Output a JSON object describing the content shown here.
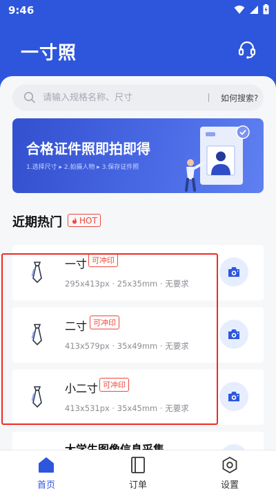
{
  "status_bar": {
    "time": "9:46"
  },
  "header": {
    "title": "一寸照"
  },
  "search": {
    "placeholder": "请输入规格名称、尺寸",
    "help_label": "如何搜索?"
  },
  "banner": {
    "title": "合格证件照即拍即得",
    "steps": "1.选择尺寸 ▸ 2.拍摄人物 ▸ 3.保存证件照"
  },
  "section": {
    "title": "近期热门",
    "hot_label": "HOT"
  },
  "specs": [
    {
      "name": "一寸",
      "tag": "可冲印",
      "spec": "295x413px · 25x35mm · 无要求"
    },
    {
      "name": "二寸",
      "tag": "可冲印",
      "spec": "413x579px · 35x49mm · 无要求"
    },
    {
      "name": "小二寸",
      "tag": "可冲印",
      "spec": "413x531px · 35x45mm · 无要求"
    },
    {
      "name": "大学生图像信息采集"
    }
  ],
  "tabbar": {
    "items": [
      {
        "label": "首页",
        "active": true
      },
      {
        "label": "订单",
        "active": false
      },
      {
        "label": "设置",
        "active": false
      }
    ]
  },
  "colors": {
    "brand": "#2e56dc",
    "hot_red": "#f0453a",
    "highlight_red": "#ee2a22"
  }
}
